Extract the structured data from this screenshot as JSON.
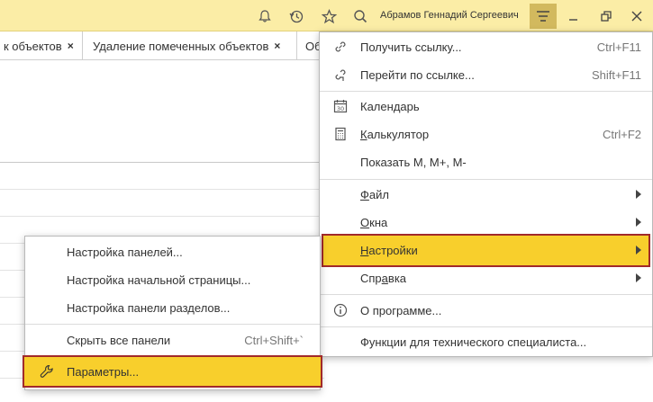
{
  "topbar": {
    "user_name": "Абрамов Геннадий Сергеевич",
    "icons": [
      "bell-icon",
      "history-icon",
      "star-icon",
      "search-icon",
      "main-menu-icon",
      "minimize-icon",
      "restore-icon",
      "close-icon"
    ]
  },
  "tabs": [
    {
      "label": "к объектов",
      "close": "×"
    },
    {
      "label": "Удаление помеченных объектов",
      "close": "×"
    },
    {
      "label": "Об"
    }
  ],
  "main_menu": {
    "items": [
      {
        "label": "Получить ссылку...",
        "shortcut": "Ctrl+F11",
        "icon": "link-icon"
      },
      {
        "label": "Перейти по ссылке...",
        "shortcut": "Shift+F11",
        "icon": "goto-link-icon"
      },
      {
        "label": "Календарь",
        "icon": "calendar-icon",
        "icon_text": "30"
      },
      {
        "label": "Калькулятор",
        "shortcut": "Ctrl+F2",
        "icon": "calculator-icon"
      },
      {
        "label": "Показать M, M+, M-"
      },
      {
        "label": "Файл",
        "submenu": true
      },
      {
        "label": "Окна",
        "submenu": true
      },
      {
        "label": "Настройки",
        "submenu": true,
        "highlighted": true
      },
      {
        "label": "Справка",
        "submenu": true
      },
      {
        "label": "О программе...",
        "icon": "info-icon"
      },
      {
        "label": "Функции для технического специалиста..."
      }
    ]
  },
  "settings_submenu": {
    "items": [
      {
        "label": "Настройка панелей..."
      },
      {
        "label": "Настройка начальной страницы..."
      },
      {
        "label": "Настройка панели разделов..."
      },
      {
        "label": "Скрыть все панели",
        "shortcut": "Ctrl+Shift+`"
      },
      {
        "label": "Параметры...",
        "icon": "wrench-icon",
        "highlighted": true
      }
    ]
  },
  "colors": {
    "topbar_bg": "#fbeda6",
    "highlight": "#f8cf2c",
    "highlight_border": "#a12a2a"
  }
}
